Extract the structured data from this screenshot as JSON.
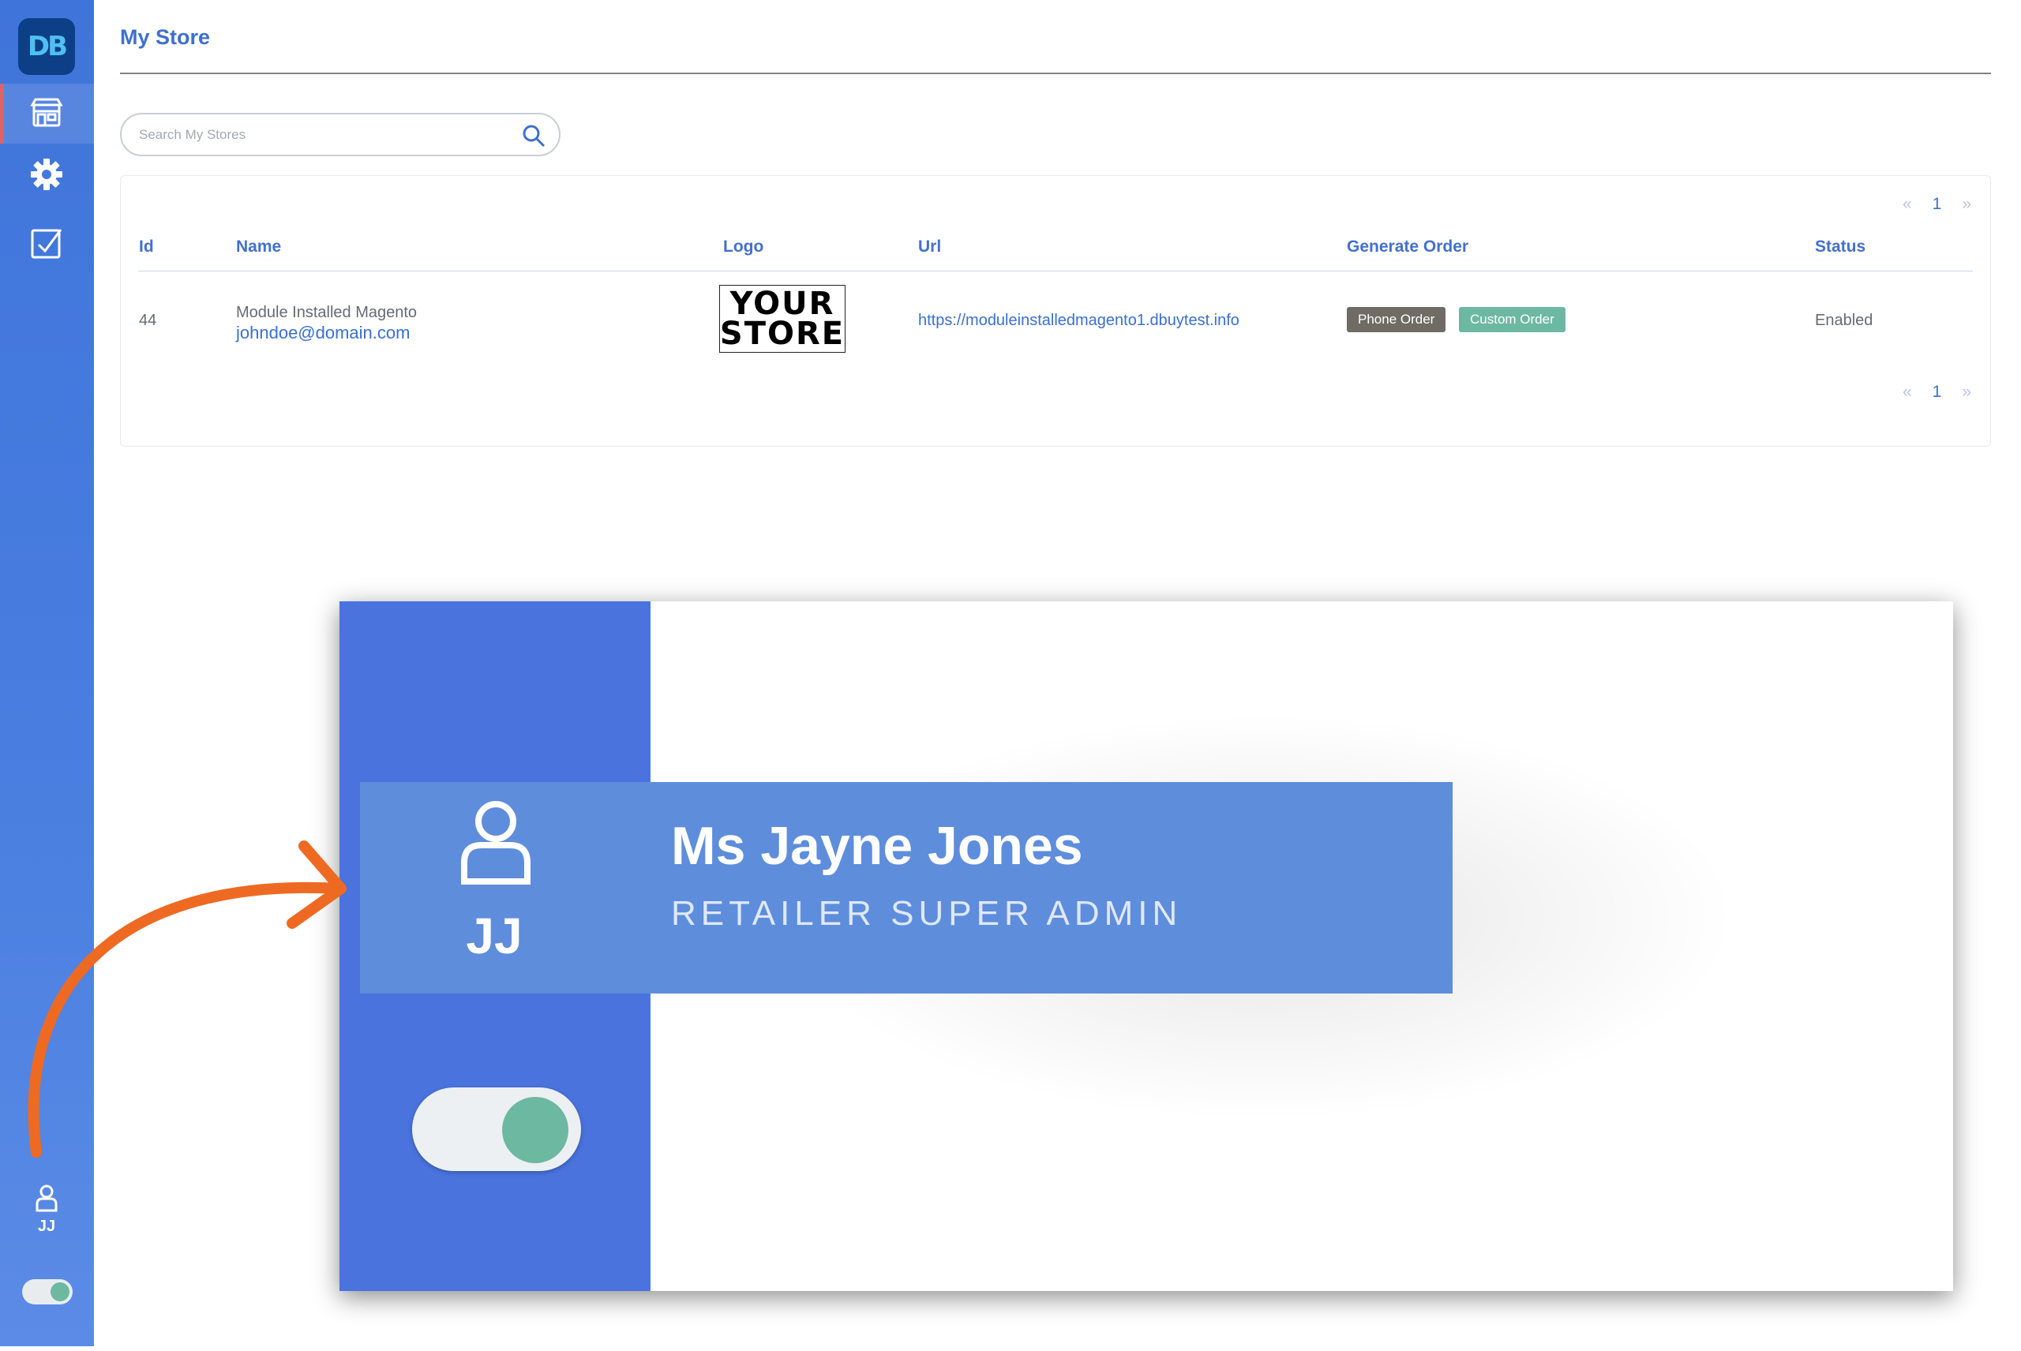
{
  "app": {
    "logo_text": "DB"
  },
  "sidebar": {
    "nav": [
      {
        "id": "stores",
        "icon": "store-icon",
        "active": true
      },
      {
        "id": "settings",
        "icon": "gear-icon",
        "active": false
      },
      {
        "id": "tasks",
        "icon": "checkbox-icon",
        "active": false
      }
    ],
    "user": {
      "initials": "JJ"
    }
  },
  "page": {
    "title": "My Store"
  },
  "search": {
    "placeholder": "Search My Stores",
    "value": ""
  },
  "pagination": {
    "prev": "«",
    "current": "1",
    "next": "»"
  },
  "table": {
    "columns": [
      "Id",
      "Name",
      "Logo",
      "Url",
      "Generate Order",
      "Status"
    ],
    "rows": [
      {
        "id": "44",
        "name": "Module Installed Magento",
        "email": "johndoe@domain.com",
        "logo_line1": "YOUR",
        "logo_line2": "STORE",
        "url": "https://moduleinstalledmagento1.dbuytest.info",
        "orders": [
          "Phone Order",
          "Custom Order"
        ],
        "status": "Enabled"
      }
    ]
  },
  "zoom": {
    "initials": "JJ",
    "name": "Ms Jayne Jones",
    "role": "RETAILER SUPER ADMIN"
  },
  "colors": {
    "sidebar": "#4a7fe0",
    "accent": "#3f6fd0",
    "phone_badge": "#706c65",
    "custom_badge": "#6db8a0",
    "arrow": "#ee6a22",
    "active_marker": "#e0616a"
  }
}
